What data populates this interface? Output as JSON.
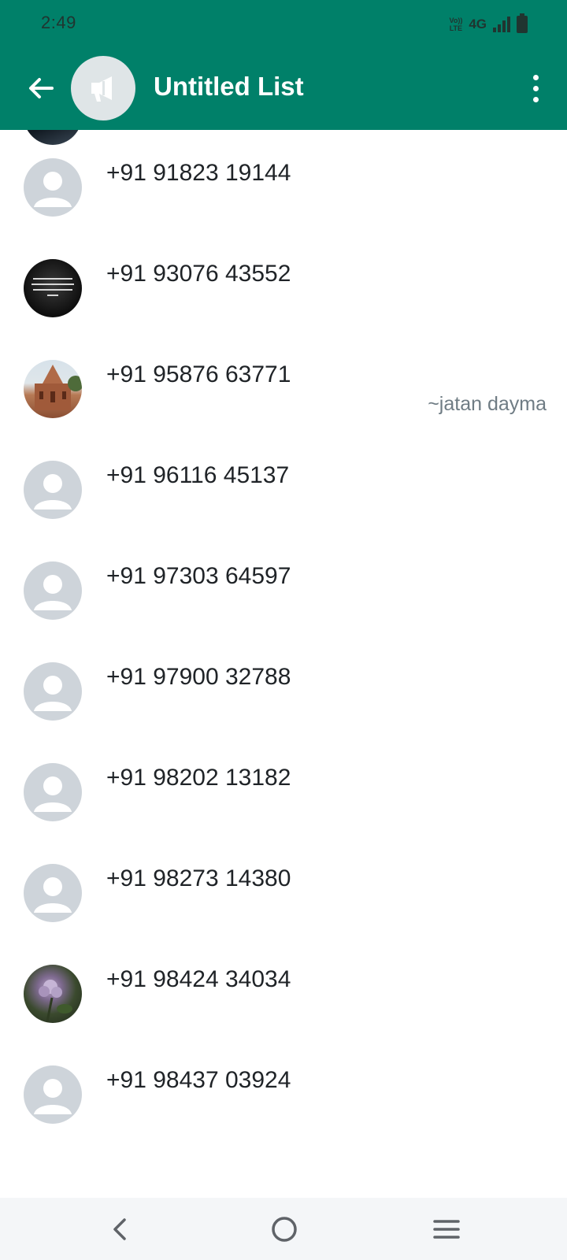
{
  "status_bar": {
    "time": "2:49",
    "volte_line1": "Vo))",
    "volte_line2": "LTE",
    "network": "4G"
  },
  "header": {
    "title": "Untitled List",
    "icons": {
      "back": "arrow-left-icon",
      "avatar": "broadcast-megaphone-icon",
      "menu": "more-vertical-icon"
    }
  },
  "recipients": [
    {
      "phone": "+91 91823 19144",
      "subtitle": "",
      "avatar": "placeholder"
    },
    {
      "phone": "+91 93076 43552",
      "subtitle": "",
      "avatar": "photo-quote"
    },
    {
      "phone": "+91 95876 63771",
      "subtitle": "~jatan dayma",
      "avatar": "photo-temple"
    },
    {
      "phone": "+91 96116 45137",
      "subtitle": "",
      "avatar": "placeholder"
    },
    {
      "phone": "+91 97303 64597",
      "subtitle": "",
      "avatar": "placeholder"
    },
    {
      "phone": "+91 97900 32788",
      "subtitle": "",
      "avatar": "placeholder"
    },
    {
      "phone": "+91 98202 13182",
      "subtitle": "",
      "avatar": "placeholder"
    },
    {
      "phone": "+91 98273 14380",
      "subtitle": "",
      "avatar": "placeholder"
    },
    {
      "phone": "+91 98424 34034",
      "subtitle": "",
      "avatar": "photo-flower"
    },
    {
      "phone": "+91 98437 03924",
      "subtitle": "",
      "avatar": "placeholder"
    }
  ],
  "colors": {
    "app_bar": "#008069",
    "placeholder_avatar": "#ced4da",
    "subtitle_text": "#6f7c84"
  },
  "navbar": {
    "icons": [
      "back-chevron-icon",
      "home-circle-icon",
      "recents-menu-icon"
    ]
  }
}
